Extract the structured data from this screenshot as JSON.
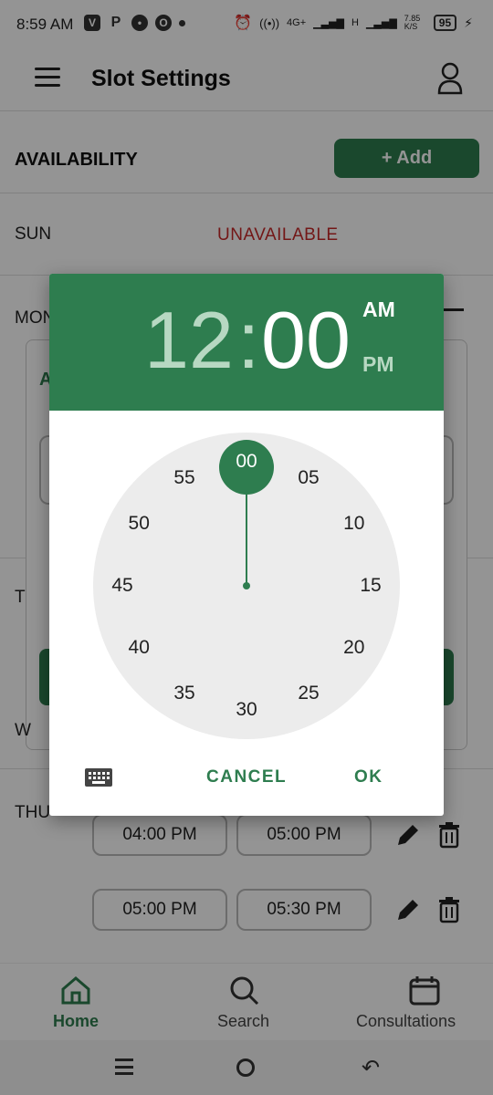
{
  "status_bar": {
    "time": "8:59 AM",
    "notif_icons": [
      "V",
      "P",
      "chat",
      "O"
    ],
    "net_speed": "7.85 K/S",
    "battery": "95",
    "network": [
      "4G+",
      "H"
    ]
  },
  "app_bar": {
    "title": "Slot Settings"
  },
  "availability": {
    "label": "AVAILABILITY",
    "add_label": "+ Add"
  },
  "days": {
    "sun": "SUN",
    "sun_status": "UNAVAILABLE",
    "mon": "MON",
    "tue": "T",
    "wed": "W",
    "thu": "THU"
  },
  "thu_slots": [
    {
      "start": "04:00 PM",
      "end": "05:00 PM"
    },
    {
      "start": "05:00 PM",
      "end": "05:30 PM"
    }
  ],
  "bottom_nav": {
    "items": [
      {
        "label": "Home",
        "active": true
      },
      {
        "label": "Search",
        "active": false
      },
      {
        "label": "Consultations",
        "active": false
      }
    ]
  },
  "time_picker": {
    "hour": "12",
    "separator": ":",
    "minute": "00",
    "am": "AM",
    "pm": "PM",
    "selected_period": "AM",
    "selected_minute": "00",
    "dial": [
      "00",
      "05",
      "10",
      "15",
      "20",
      "25",
      "30",
      "35",
      "40",
      "45",
      "50",
      "55"
    ],
    "cancel": "CANCEL",
    "ok": "OK"
  },
  "colors": {
    "primary": "#2e7d4f",
    "unavailable": "#c62828",
    "dial_bg": "#ececec"
  }
}
